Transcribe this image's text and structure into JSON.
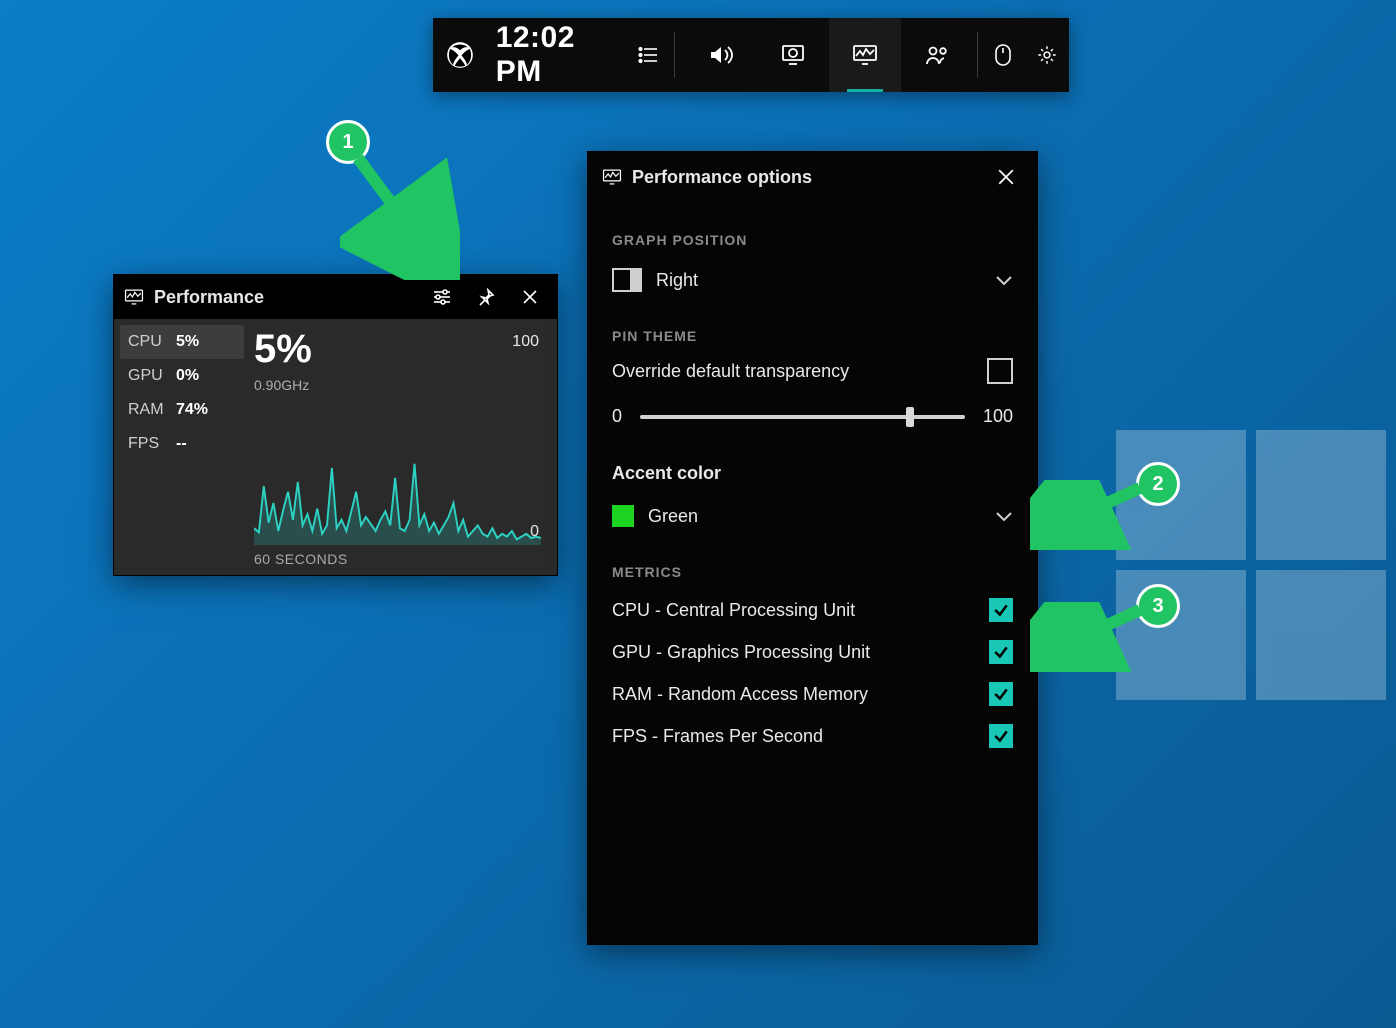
{
  "gamebar": {
    "clock": "12:02 PM"
  },
  "perf": {
    "title": "Performance",
    "metrics": [
      {
        "label": "CPU",
        "value": "5%",
        "selected": true
      },
      {
        "label": "GPU",
        "value": "0%",
        "selected": false
      },
      {
        "label": "RAM",
        "value": "74%",
        "selected": false
      },
      {
        "label": "FPS",
        "value": "--",
        "selected": false
      }
    ],
    "big_value": "5%",
    "sub_value": "0.90GHz",
    "y_max": "100",
    "y_min": "0",
    "x_label": "60 SECONDS"
  },
  "options": {
    "title": "Performance options",
    "graph_position": {
      "heading": "GRAPH POSITION",
      "value": "Right"
    },
    "pin_theme": {
      "heading": "PIN THEME",
      "override_label": "Override default transparency",
      "override_checked": false,
      "slider_min": "0",
      "slider_max": "100",
      "slider_value": 82
    },
    "accent": {
      "heading": "Accent color",
      "value": "Green",
      "swatch": "#1fd321"
    },
    "metrics": {
      "heading": "METRICS",
      "items": [
        {
          "label": "CPU - Central Processing Unit",
          "checked": true
        },
        {
          "label": "GPU - Graphics Processing Unit",
          "checked": true
        },
        {
          "label": "RAM - Random Access Memory",
          "checked": true
        },
        {
          "label": "FPS - Frames Per Second",
          "checked": true
        }
      ]
    }
  },
  "annotations": {
    "b1": "1",
    "b2": "2",
    "b3": "3"
  },
  "chart_data": {
    "type": "line",
    "title": "CPU usage",
    "xlabel": "60 SECONDS",
    "ylabel": "",
    "ylim": [
      0,
      100
    ],
    "x": [
      0,
      1,
      2,
      3,
      4,
      5,
      6,
      7,
      8,
      9,
      10,
      11,
      12,
      13,
      14,
      15,
      16,
      17,
      18,
      19,
      20,
      21,
      22,
      23,
      24,
      25,
      26,
      27,
      28,
      29,
      30,
      31,
      32,
      33,
      34,
      35,
      36,
      37,
      38,
      39,
      40,
      41,
      42,
      43,
      44,
      45,
      46,
      47,
      48,
      49,
      50,
      51,
      52,
      53,
      54,
      55,
      56,
      57,
      58,
      59
    ],
    "values": [
      12,
      9,
      42,
      16,
      30,
      10,
      25,
      38,
      18,
      45,
      14,
      22,
      10,
      26,
      8,
      14,
      55,
      12,
      18,
      10,
      24,
      38,
      14,
      20,
      15,
      10,
      18,
      24,
      14,
      48,
      12,
      10,
      18,
      58,
      14,
      22,
      10,
      16,
      8,
      14,
      20,
      30,
      10,
      18,
      6,
      10,
      14,
      8,
      6,
      12,
      5,
      8,
      6,
      10,
      4,
      6,
      8,
      5,
      6,
      5
    ]
  }
}
